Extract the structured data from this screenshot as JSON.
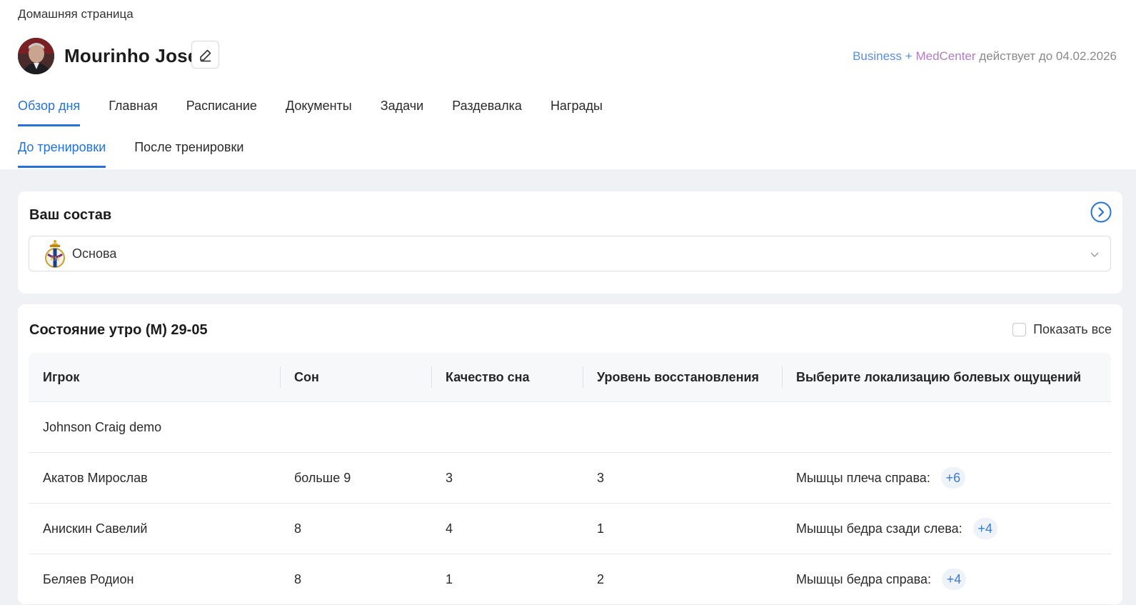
{
  "breadcrumb": "Домашняя страница",
  "user": {
    "name": "Mourinho José"
  },
  "license": {
    "plan_a": "Business",
    "plus": "+",
    "plan_b": "MedCenter",
    "valid_text": "действует до 04.02.2026"
  },
  "tabs": [
    "Обзор дня",
    "Главная",
    "Расписание",
    "Документы",
    "Задачи",
    "Раздевалка",
    "Награды"
  ],
  "subtabs": [
    "До тренировки",
    "После тренировки"
  ],
  "squad": {
    "title": "Ваш состав",
    "selected": "Основа"
  },
  "state": {
    "title": "Состояние утро (М) 29-05",
    "show_all_label": "Показать все",
    "columns": [
      "Игрок",
      "Сон",
      "Качество сна",
      "Уровень восстановления",
      "Выберите локализацию болевых ощущений"
    ],
    "rows": [
      {
        "player": "Johnson Craig demo",
        "sleep": "",
        "quality": "",
        "recovery": "",
        "pain": "",
        "more": ""
      },
      {
        "player": "Акатов Мирослав",
        "sleep": "больше 9",
        "quality": "3",
        "recovery": "3",
        "pain": "Мышцы плеча справа:",
        "more": "+6"
      },
      {
        "player": "Анискин Савелий",
        "sleep": "8",
        "quality": "4",
        "recovery": "1",
        "pain": "Мышцы бедра сзади слева:",
        "more": "+4"
      },
      {
        "player": "Беляев Родион",
        "sleep": "8",
        "quality": "1",
        "recovery": "2",
        "pain": "Мышцы бедра справа:",
        "more": "+4"
      }
    ]
  },
  "colors": {
    "accent": "#2672d9",
    "business": "#5b8fd8",
    "medcenter": "#b27cc2"
  }
}
